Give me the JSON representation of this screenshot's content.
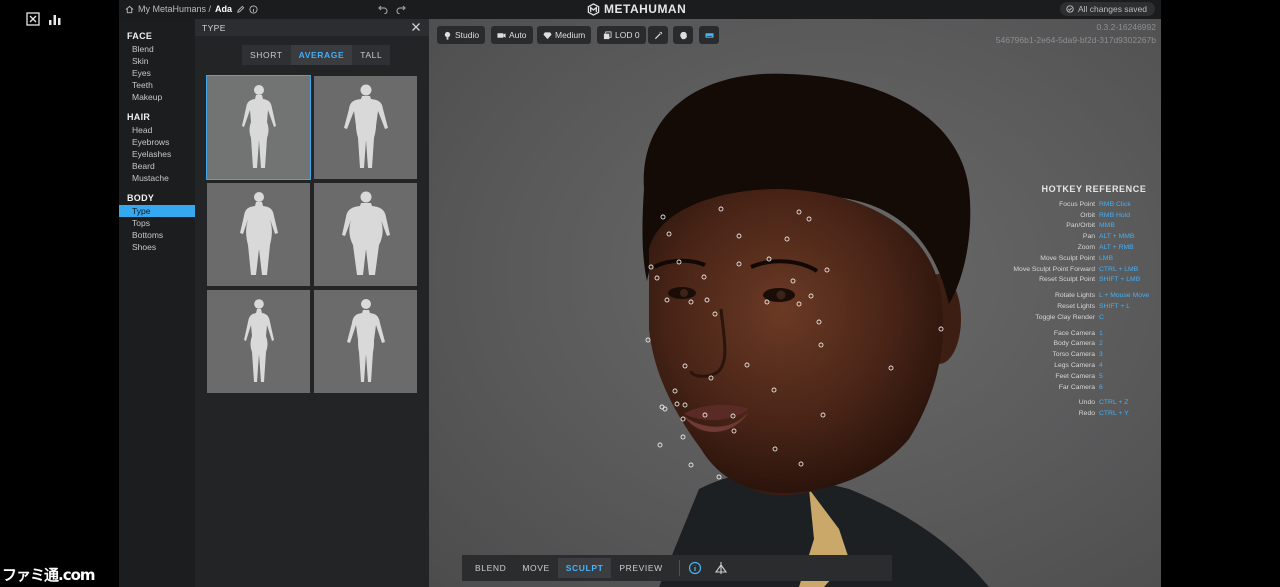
{
  "breadcrumb": {
    "root": "My MetaHumans /",
    "current": "Ada"
  },
  "brand": "METAHUMAN",
  "status": {
    "saved": "All changes saved"
  },
  "build": {
    "version": "0.3.2-16246992",
    "id": "546796b1-2e64-5da9-bf2d-317d9302267b"
  },
  "nav": {
    "face": {
      "title": "FACE",
      "items": [
        "Blend",
        "Skin",
        "Eyes",
        "Teeth",
        "Makeup"
      ]
    },
    "hair": {
      "title": "HAIR",
      "items": [
        "Head",
        "Eyebrows",
        "Eyelashes",
        "Beard",
        "Mustache"
      ]
    },
    "body": {
      "title": "BODY",
      "items": [
        "Type",
        "Tops",
        "Bottoms",
        "Shoes"
      ],
      "active": "Type"
    }
  },
  "type_panel": {
    "title": "TYPE",
    "heights": [
      "SHORT",
      "AVERAGE",
      "TALL"
    ],
    "active_height": "AVERAGE",
    "body_types": [
      "female-average",
      "male-average",
      "female-heavy",
      "male-heavy",
      "female-slim",
      "male-slim"
    ],
    "selected_index": 0
  },
  "viewport_toolbar": {
    "studio": "Studio",
    "auto": "Auto",
    "medium": "Medium",
    "lod": "LOD 0"
  },
  "hotkeys": {
    "title": "HOTKEY REFERENCE",
    "groups": [
      [
        [
          "Focus Point",
          "RMB Click"
        ],
        [
          "Orbit",
          "RMB Hold"
        ],
        [
          "Pan/Orbit",
          "MMB"
        ],
        [
          "Pan",
          "ALT + MMB"
        ],
        [
          "Zoom",
          "ALT + RMB"
        ],
        [
          "Move Sculpt Point",
          "LMB"
        ],
        [
          "Move Sculpt Point Forward",
          "CTRL + LMB"
        ],
        [
          "Reset Sculpt Point",
          "SHIFT + LMB"
        ]
      ],
      [
        [
          "Rotate Lights",
          "L + Mouse Move"
        ],
        [
          "Reset Lights",
          "SHIFT + L"
        ],
        [
          "Toggle Clay Render",
          "C"
        ]
      ],
      [
        [
          "Face Camera",
          "1"
        ],
        [
          "Body Camera",
          "2"
        ],
        [
          "Torso Camera",
          "3"
        ],
        [
          "Legs Camera",
          "4"
        ],
        [
          "Feet Camera",
          "5"
        ],
        [
          "Far Camera",
          "6"
        ]
      ],
      [
        [
          "Undo",
          "CTRL + Z"
        ],
        [
          "Redo",
          "CTRL + Y"
        ]
      ]
    ]
  },
  "modes": {
    "items": [
      "BLEND",
      "MOVE",
      "SCULPT",
      "PREVIEW"
    ],
    "active": "SCULPT"
  },
  "watermark": "ファミ通.com",
  "colors": {
    "accent": "#3fb0f5",
    "panel": "#232426",
    "viewport": "#5e5e5f"
  }
}
